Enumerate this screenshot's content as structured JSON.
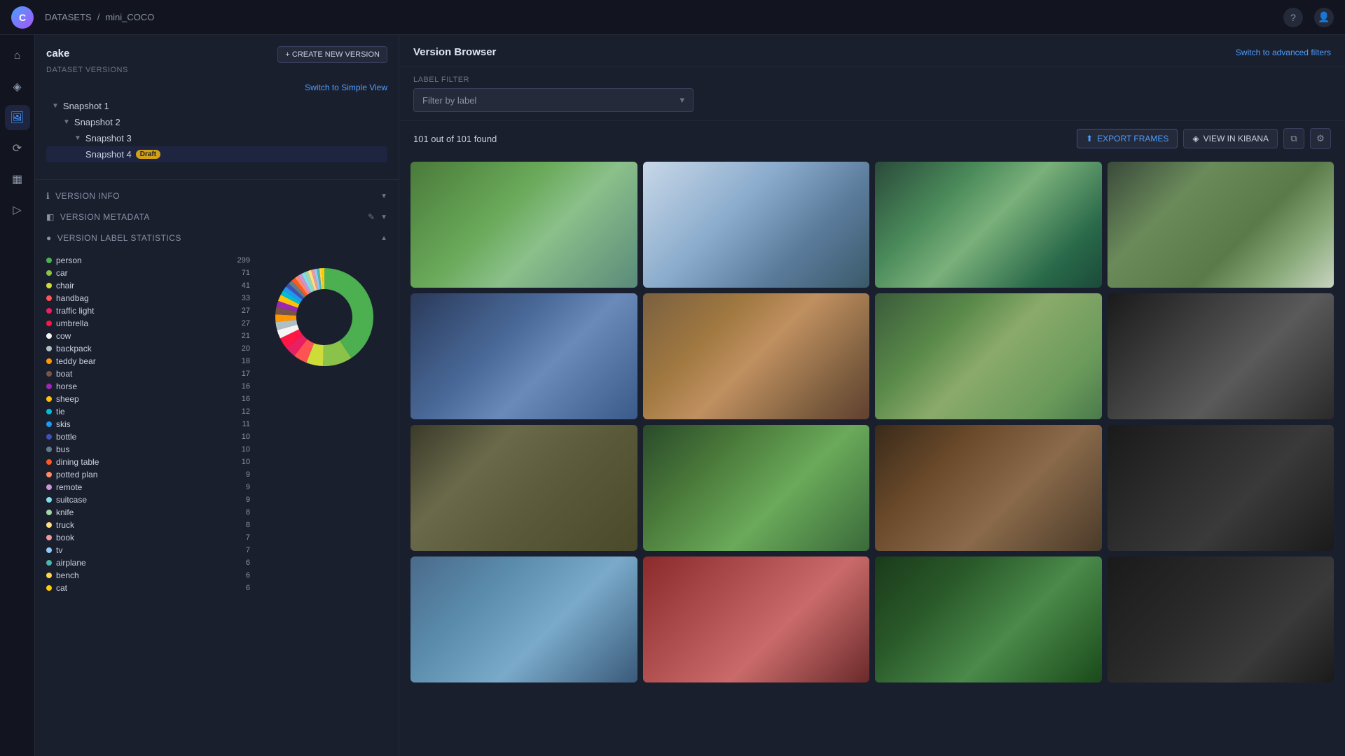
{
  "topbar": {
    "logo": "C",
    "breadcrumb": {
      "datasets": "DATASETS",
      "separator": "/",
      "current": "mini_COCO"
    },
    "help_label": "?",
    "user_label": "👤"
  },
  "sidebar": {
    "nav_items": [
      {
        "id": "home",
        "icon": "⌂",
        "label": "home-icon"
      },
      {
        "id": "data",
        "icon": "◈",
        "label": "data-icon"
      },
      {
        "id": "images",
        "icon": "🖼",
        "label": "images-icon",
        "active": true
      },
      {
        "id": "workflow",
        "icon": "⟳",
        "label": "workflow-icon"
      },
      {
        "id": "table",
        "icon": "▦",
        "label": "table-icon"
      },
      {
        "id": "plugin",
        "icon": "▷",
        "label": "plugin-icon"
      }
    ]
  },
  "left_panel": {
    "dataset_name": "cake",
    "dataset_versions_label": "DATASET VERSIONS",
    "create_version_btn": "+ CREATE NEW VERSION",
    "switch_simple_label": "Switch to Simple View",
    "versions": [
      {
        "label": "Snapshot 1",
        "depth": 0,
        "expanded": true
      },
      {
        "label": "Snapshot 2",
        "depth": 1,
        "expanded": true
      },
      {
        "label": "Snapshot 3",
        "depth": 2,
        "expanded": true
      },
      {
        "label": "Snapshot 4",
        "depth": 3,
        "badge": "Draft",
        "selected": true
      }
    ],
    "version_info_label": "VERSION INFO",
    "version_metadata_label": "VERSION METADATA",
    "version_label_stats_label": "VERSION LABEL STATISTICS",
    "labels": [
      {
        "name": "person",
        "count": 299,
        "color": "#4caf50"
      },
      {
        "name": "car",
        "count": 71,
        "color": "#8bc34a"
      },
      {
        "name": "chair",
        "count": 41,
        "color": "#cddc39"
      },
      {
        "name": "handbag",
        "count": 33,
        "color": "#ff5252"
      },
      {
        "name": "traffic light",
        "count": 27,
        "color": "#e91e63"
      },
      {
        "name": "umbrella",
        "count": 27,
        "color": "#ff1744"
      },
      {
        "name": "cow",
        "count": 21,
        "color": "#f5f5f5"
      },
      {
        "name": "backpack",
        "count": 20,
        "color": "#b0bec5"
      },
      {
        "name": "teddy bear",
        "count": 18,
        "color": "#ff9800"
      },
      {
        "name": "boat",
        "count": 17,
        "color": "#795548"
      },
      {
        "name": "horse",
        "count": 16,
        "color": "#9c27b0"
      },
      {
        "name": "sheep",
        "count": 16,
        "color": "#ffc107"
      },
      {
        "name": "tie",
        "count": 12,
        "color": "#00bcd4"
      },
      {
        "name": "skis",
        "count": 11,
        "color": "#2196f3"
      },
      {
        "name": "bottle",
        "count": 10,
        "color": "#3f51b5"
      },
      {
        "name": "bus",
        "count": 10,
        "color": "#607d8b"
      },
      {
        "name": "dining table",
        "count": 10,
        "color": "#ff5722"
      },
      {
        "name": "potted plan",
        "count": 9,
        "color": "#ff8a65"
      },
      {
        "name": "remote",
        "count": 9,
        "color": "#ce93d8"
      },
      {
        "name": "suitcase",
        "count": 9,
        "color": "#80deea"
      },
      {
        "name": "knife",
        "count": 8,
        "color": "#a5d6a7"
      },
      {
        "name": "truck",
        "count": 8,
        "color": "#ffe082"
      },
      {
        "name": "book",
        "count": 7,
        "color": "#ef9a9a"
      },
      {
        "name": "tv",
        "count": 7,
        "color": "#90caf9"
      },
      {
        "name": "airplane",
        "count": 6,
        "color": "#4db6ac"
      },
      {
        "name": "bench",
        "count": 6,
        "color": "#ffd54f"
      },
      {
        "name": "cat",
        "count": 6,
        "color": "#ffcc02"
      }
    ]
  },
  "version_browser": {
    "title": "Version Browser",
    "adv_filters": "Switch to advanced filters",
    "label_filter_label": "LABEL FILTER",
    "filter_placeholder": "Filter by label",
    "results_count": "101 out of 101 found",
    "export_btn": "EXPORT FRAMES",
    "kibana_btn": "VIEW IN KIBANA",
    "images": [
      {
        "id": 1,
        "cls": "img-1"
      },
      {
        "id": 2,
        "cls": "img-2"
      },
      {
        "id": 3,
        "cls": "img-3"
      },
      {
        "id": 4,
        "cls": "img-4"
      },
      {
        "id": 5,
        "cls": "img-5"
      },
      {
        "id": 6,
        "cls": "img-6"
      },
      {
        "id": 7,
        "cls": "img-7"
      },
      {
        "id": 8,
        "cls": "img-8"
      },
      {
        "id": 9,
        "cls": "img-9"
      },
      {
        "id": 10,
        "cls": "img-10"
      },
      {
        "id": 11,
        "cls": "img-11"
      },
      {
        "id": 12,
        "cls": "img-12"
      },
      {
        "id": 13,
        "cls": "img-13"
      },
      {
        "id": 14,
        "cls": "img-14"
      },
      {
        "id": 15,
        "cls": "img-15"
      },
      {
        "id": 16,
        "cls": "img-16"
      }
    ]
  }
}
